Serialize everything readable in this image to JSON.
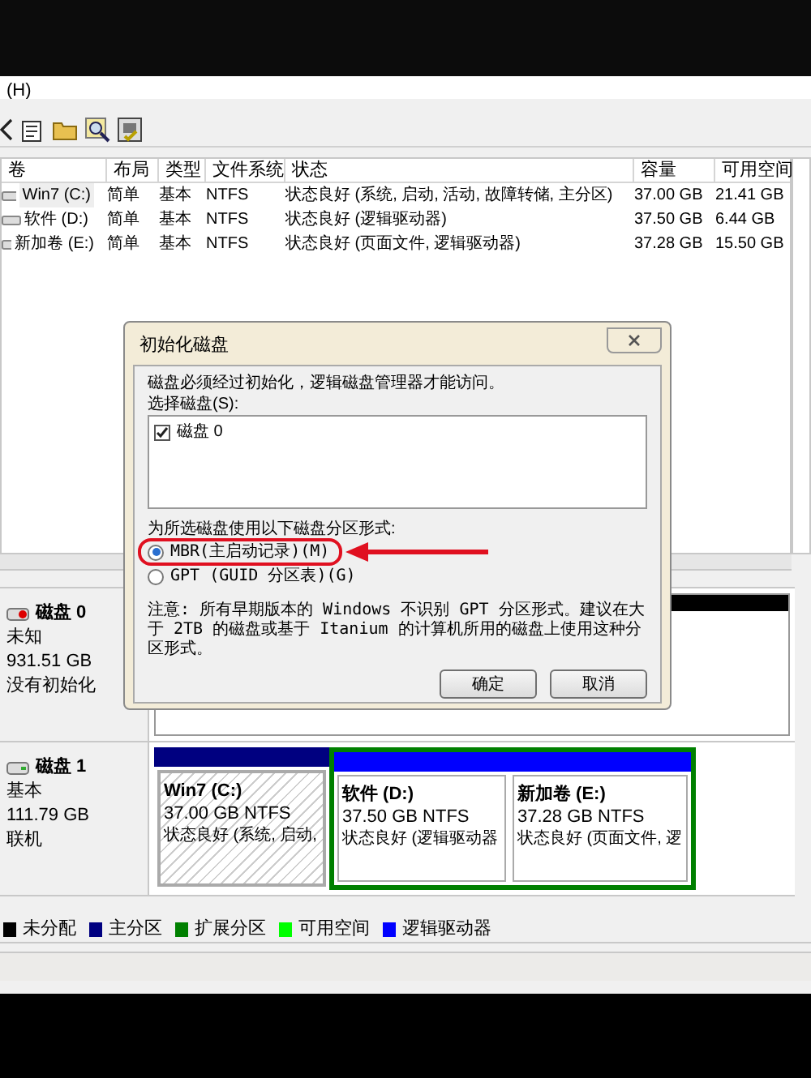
{
  "menu_bar": {
    "items": [
      "(H)"
    ]
  },
  "volume_table": {
    "columns": [
      "卷",
      "布局",
      "类型",
      "文件系统",
      "状态",
      "容量",
      "可用空间"
    ],
    "rows": [
      {
        "kind": "system",
        "cells": [
          "Win7 (C:)",
          "简单",
          "基本",
          "NTFS",
          "状态良好 (系统, 启动, 活动, 故障转储, 主分区)",
          "37.00 GB",
          "21.41 GB"
        ]
      },
      {
        "kind": "normal",
        "cells": [
          "软件 (D:)",
          "简单",
          "基本",
          "NTFS",
          "状态良好 (逻辑驱动器)",
          "37.50 GB",
          "6.44 GB"
        ]
      },
      {
        "kind": "normal",
        "cells": [
          "新加卷 (E:)",
          "简单",
          "基本",
          "NTFS",
          "状态良好 (页面文件, 逻辑驱动器)",
          "37.28 GB",
          "15.50 GB"
        ]
      }
    ]
  },
  "disks": [
    {
      "name": "磁盘 0",
      "kind": "uninitialized",
      "type": "未知",
      "size": "931.51 GB",
      "status": "没有初始化",
      "partitions": [
        {
          "kind": "unallocated"
        }
      ]
    },
    {
      "name": "磁盘 1",
      "kind": "online",
      "type": "基本",
      "size": "111.79 GB",
      "status": "联机",
      "partitions": [
        {
          "kind": "primary",
          "title": "Win7  (C:)",
          "size": "37.00 GB NTFS",
          "status": "状态良好 (系统, 启动,"
        },
        {
          "kind": "logical",
          "title": "软件  (D:)",
          "size": "37.50 GB NTFS",
          "status": "状态良好 (逻辑驱动器"
        },
        {
          "kind": "logical",
          "title": "新加卷  (E:)",
          "size": "37.28 GB NTFS",
          "status": "状态良好 (页面文件, 逻"
        }
      ]
    }
  ],
  "legend": [
    {
      "label": "未分配",
      "color": "#000000"
    },
    {
      "label": "主分区",
      "color": "#000080"
    },
    {
      "label": "扩展分区",
      "color": "#008000"
    },
    {
      "label": "可用空间",
      "color": "#00ff00"
    },
    {
      "label": "逻辑驱动器",
      "color": "#0000ff"
    }
  ],
  "dialog": {
    "title": "初始化磁盘",
    "message": "磁盘必须经过初始化，逻辑磁盘管理器才能访问。",
    "disk_list_label": "选择磁盘(S):",
    "disk_items": [
      {
        "label": "磁盘 0",
        "checked": true
      }
    ],
    "style_label": "为所选磁盘使用以下磁盘分区形式:",
    "styles": [
      {
        "label": "MBR(主启动记录)(M)",
        "selected": true
      },
      {
        "label": "GPT (GUID 分区表)(G)",
        "selected": false
      }
    ],
    "note": "注意: 所有早期版本的 Windows 不识别 GPT 分区形式。建议在大于 2TB 的磁盘或基于 Itanium 的计算机所用的磁盘上使用这种分区形式。",
    "buttons": [
      "确定",
      "取消"
    ]
  }
}
